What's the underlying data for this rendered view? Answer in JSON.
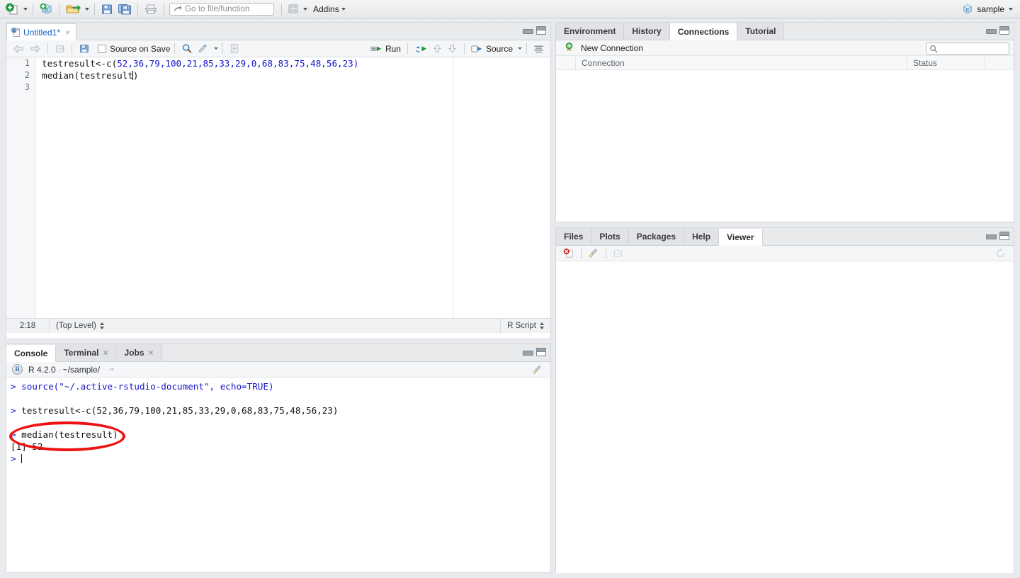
{
  "toolbar": {
    "icons": [
      {
        "name": "new-file-icon",
        "label": "New File"
      },
      {
        "name": "new-project-icon",
        "label": "New Project"
      },
      {
        "name": "open-file-icon",
        "label": "Open File"
      },
      {
        "name": "save-icon",
        "label": "Save"
      },
      {
        "name": "save-all-icon",
        "label": "Save All"
      },
      {
        "name": "print-icon",
        "label": "Print"
      },
      {
        "name": "grid-panes-icon",
        "label": "Workspace Panes"
      }
    ],
    "goto_placeholder": "Go to file/function",
    "addins_label": "Addins",
    "session_label": "sample"
  },
  "source": {
    "tab": {
      "filename": "Untitled1*",
      "close": "×"
    },
    "toolbar": {
      "back_icon": "back-arrow-icon",
      "forward_icon": "forward-arrow-icon",
      "popout_icon": "show-in-new-window-icon",
      "save_icon": "save-icon",
      "source_on_save_label": "Source on Save",
      "find_icon": "find-replace-icon",
      "magic_icon": "code-tools-icon",
      "compile_icon": "compile-report-icon",
      "run_label": "Run",
      "rerun_icon": "rerun-icon",
      "prev_chunk_icon": "up-arrow-icon",
      "next_chunk_icon": "down-arrow-icon",
      "source_label": "Source",
      "outline_icon": "document-outline-icon"
    },
    "line_numbers": [
      "1",
      "2",
      "3"
    ],
    "code": {
      "line1_prefix": "testresult<-c(",
      "line1_numbers": "52,36,79,100,21,85,33,29,0,68,83,75,48,56,23",
      "line1_suffix": ")",
      "line2_before_caret": "median(testresult",
      "line2_after_caret": ")",
      "line3": ""
    },
    "status": {
      "position": "2:18",
      "scope": "(Top Level)",
      "filetype": "R Script"
    }
  },
  "console": {
    "tabs": [
      {
        "label": "Console",
        "active": true,
        "closable": false
      },
      {
        "label": "Terminal",
        "active": false,
        "closable": true
      },
      {
        "label": "Jobs",
        "active": false,
        "closable": true
      }
    ],
    "close_glyph": "×",
    "r_badge": "R",
    "version": "R 4.2.0",
    "separator": "·",
    "path": "~/sample/",
    "popout_icon": "show-in-new-window-icon",
    "clear_icon": "broom-icon",
    "lines": [
      {
        "type": "input",
        "prompt": "> ",
        "text": "source(\"~/.active-rstudio-document\", echo=TRUE)"
      },
      {
        "type": "blank",
        "prompt": "",
        "text": ""
      },
      {
        "type": "input",
        "prompt": "> ",
        "text": "testresult<-c(52,36,79,100,21,85,33,29,0,68,83,75,48,56,23)"
      },
      {
        "type": "blank",
        "prompt": "",
        "text": ""
      },
      {
        "type": "input",
        "prompt": "> ",
        "text": "median(testresult)"
      },
      {
        "type": "output",
        "prompt": "",
        "text": "[1] 52"
      },
      {
        "type": "prompt-only",
        "prompt": "> ",
        "text": ""
      }
    ],
    "annotation": {
      "shape": "ellipse",
      "color": "#ee1111",
      "stroke_width": 4
    }
  },
  "environment": {
    "tabs": [
      {
        "label": "Environment",
        "active": false
      },
      {
        "label": "History",
        "active": false
      },
      {
        "label": "Connections",
        "active": true
      },
      {
        "label": "Tutorial",
        "active": false
      }
    ],
    "new_connection_label": "New Connection",
    "new_connection_icon": "new-connection-icon",
    "search_icon": "search-icon",
    "search_value": "",
    "columns": [
      "",
      "Connection",
      "Status",
      ""
    ],
    "rows": []
  },
  "viewer": {
    "tabs": [
      {
        "label": "Files",
        "active": false
      },
      {
        "label": "Plots",
        "active": false
      },
      {
        "label": "Packages",
        "active": false
      },
      {
        "label": "Help",
        "active": false
      },
      {
        "label": "Viewer",
        "active": true
      }
    ],
    "stop_icon": "stop-icon",
    "clear_icon": "broom-icon",
    "popout_icon": "show-in-new-window-icon",
    "refresh_icon": "refresh-icon"
  },
  "colors": {
    "accent_blue": "#1414cc",
    "link_blue": "#1161c4",
    "annotation_red": "#ee1111",
    "toolbar_bg": "#eef0f2",
    "pane_bg": "#ffffff",
    "tab_inactive": "#e1e3e6"
  }
}
